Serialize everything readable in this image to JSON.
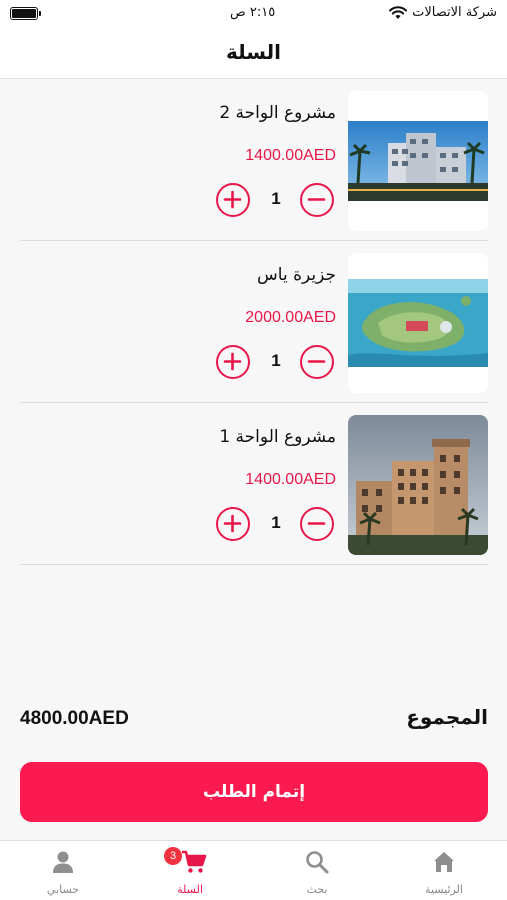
{
  "status_bar": {
    "carrier": "شركة الاتصالات",
    "time": "٢:١٥ ص",
    "icons": [
      "wifi-icon",
      "battery-icon"
    ]
  },
  "header": {
    "title": "السلة"
  },
  "cart": {
    "items": [
      {
        "name": "مشروع الواحة 2",
        "price": "1400.00AED",
        "quantity": "1",
        "image": "modern-apartment-building-photo"
      },
      {
        "name": "جزيرة ياس",
        "price": "2000.00AED",
        "quantity": "1",
        "image": "aerial-island-photo"
      },
      {
        "name": "مشروع الواحة 1",
        "price": "1400.00AED",
        "quantity": "1",
        "image": "residential-tower-photo"
      }
    ]
  },
  "summary": {
    "total_label": "المجموع",
    "total_value": "4800.00AED"
  },
  "checkout": {
    "label": "إتمام الطلب"
  },
  "tab_bar": {
    "tabs": [
      {
        "label": "الرئيسية",
        "icon": "home-icon",
        "active": false
      },
      {
        "label": "بحث",
        "icon": "search-icon",
        "active": false
      },
      {
        "label": "السلة",
        "icon": "cart-icon",
        "active": true,
        "badge": "3"
      },
      {
        "label": "حسابي",
        "icon": "user-icon",
        "active": false
      }
    ]
  },
  "colors": {
    "accent": "#fb1a4f",
    "price": "#e8174a",
    "background": "#f7f7f7"
  }
}
